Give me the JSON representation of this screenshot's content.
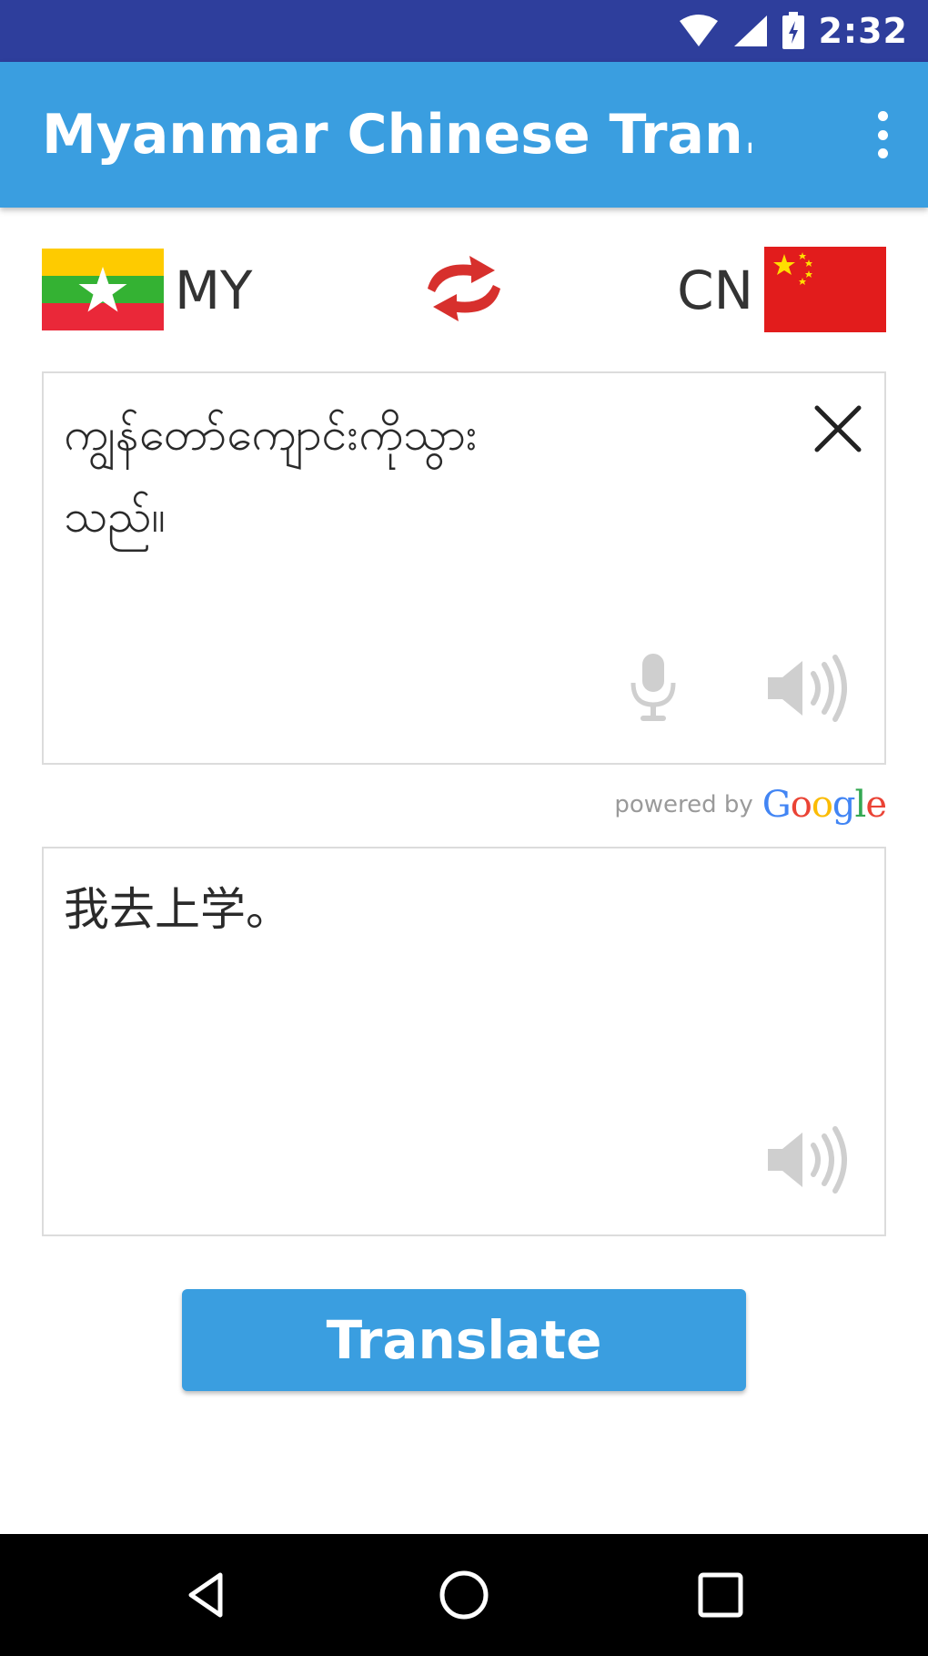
{
  "status_bar": {
    "time": "2:32",
    "icons": [
      "wifi-icon",
      "signal-icon",
      "battery-icon"
    ],
    "background": "#2e3e9c"
  },
  "app_bar": {
    "title": "Myanmar Chinese Tran...",
    "background": "#3a9ee0",
    "menu_icon": "overflow-menu-icon"
  },
  "languages": {
    "source_code": "MY",
    "target_code": "CN",
    "source_flag": "myanmar-flag-icon",
    "target_flag": "china-flag-icon",
    "swap_icon": "swap-arrows-icon",
    "swap_color": "#d7302d"
  },
  "source": {
    "text": "ကျွန်တော်ကျောင်းကိုသွား\nသည်။",
    "icons": [
      "close-icon",
      "microphone-icon",
      "speaker-icon"
    ]
  },
  "powered_by": {
    "text": "powered by",
    "brand": "Google",
    "brand_colors": [
      "#4285f4",
      "#ea4335",
      "#fbbc05",
      "#4285f4",
      "#34a853",
      "#ea4335"
    ]
  },
  "target": {
    "text": "我去上学。",
    "icons": [
      "speaker-icon"
    ]
  },
  "translate_button": {
    "label": "Translate",
    "background": "#3a9ee0"
  },
  "nav_bar": {
    "icons": [
      "back-icon",
      "home-icon",
      "recents-icon"
    ]
  }
}
